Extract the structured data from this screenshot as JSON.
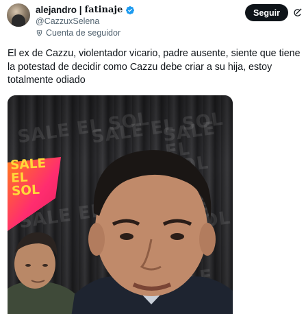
{
  "author": {
    "display_name": "alejandro |",
    "display_name_styled": "fatinaje",
    "handle": "@CazzuxSelena",
    "follower_label": "Cuenta de seguidor"
  },
  "actions": {
    "follow_label": "Seguir"
  },
  "tweet": {
    "text": "El ex de Cazzu, violentador vicario, padre ausente, siente que tiene la potestad de decidir como Cazzu debe criar a su hija, estoy totalmente odiado"
  },
  "media": {
    "badge_text": "SALE EL SOL",
    "watermark_text": "SALE EL SOL"
  },
  "icons": {
    "verified": "verified-badge-icon",
    "follower": "follower-account-icon",
    "grok": "grok-icon"
  },
  "colors": {
    "text_primary": "#0f1419",
    "text_secondary": "#536471",
    "verified_blue": "#1d9bf0",
    "button_bg": "#0f1419",
    "badge_pink": "#ff2d6f",
    "badge_orange": "#ff7a1a",
    "badge_yellow": "#ffd83a"
  }
}
